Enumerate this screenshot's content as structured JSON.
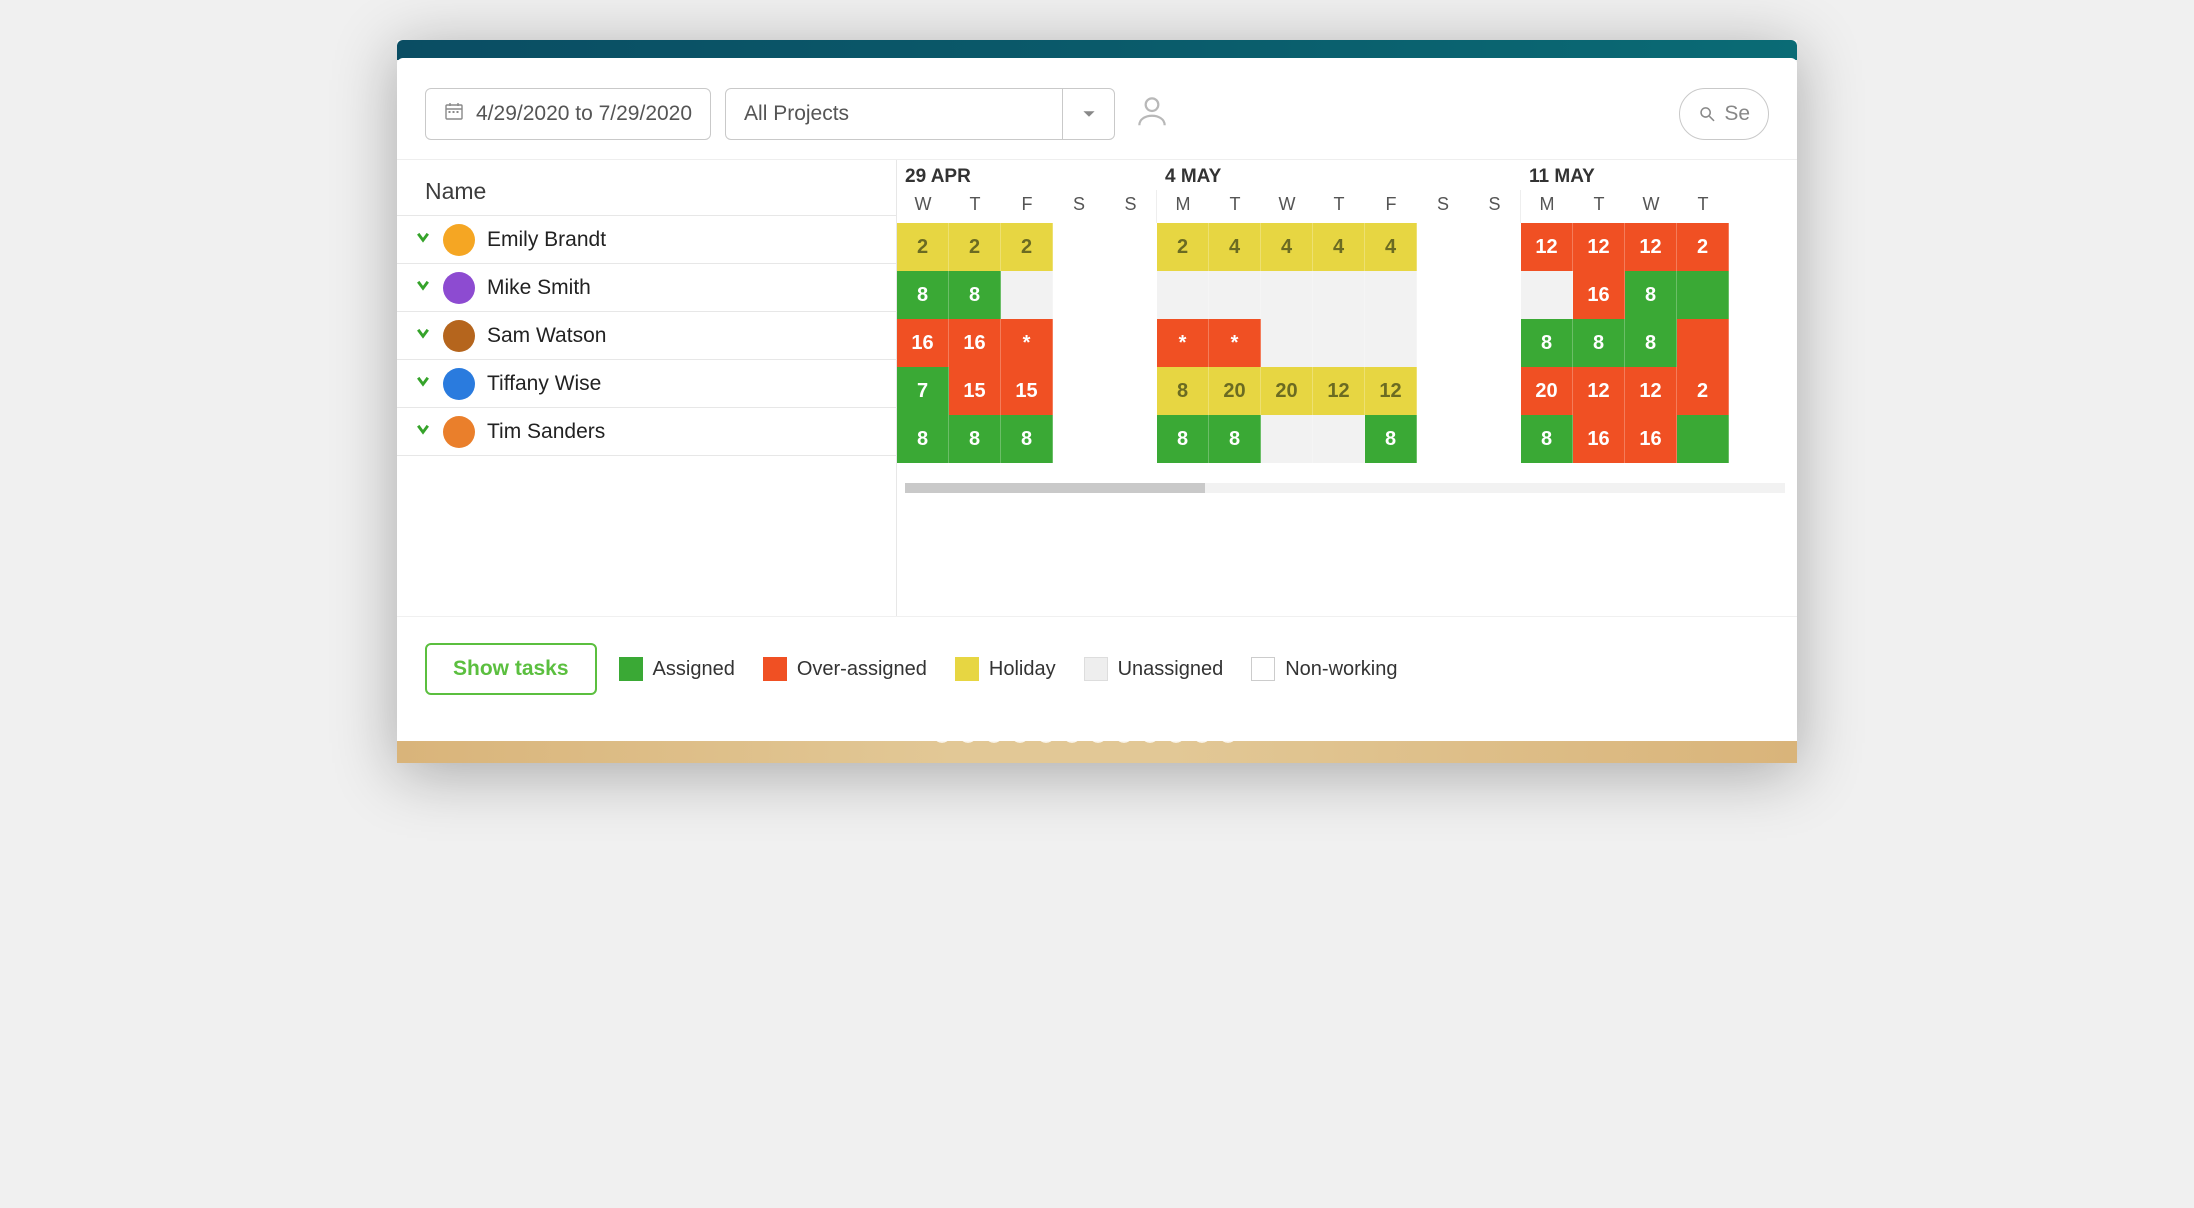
{
  "toolbar": {
    "date_range": "4/29/2020 to 7/29/2020",
    "project_filter": "All Projects",
    "search_placeholder": "Se"
  },
  "header": {
    "name_col": "Name"
  },
  "weeks": [
    {
      "title": "29 APR",
      "days": [
        "W",
        "T",
        "F",
        "S",
        "S"
      ]
    },
    {
      "title": "4 MAY",
      "days": [
        "M",
        "T",
        "W",
        "T",
        "F",
        "S",
        "S"
      ]
    },
    {
      "title": "11 MAY",
      "days": [
        "M",
        "T",
        "W",
        "T"
      ]
    }
  ],
  "rows": [
    {
      "name": "Emily Brandt",
      "avatar": "#f5a623",
      "cells": [
        {
          "v": "2",
          "c": "y"
        },
        {
          "v": "2",
          "c": "y"
        },
        {
          "v": "2",
          "c": "y"
        },
        {
          "v": "",
          "c": "nw"
        },
        {
          "v": "",
          "c": "nw"
        },
        {
          "v": "2",
          "c": "y"
        },
        {
          "v": "4",
          "c": "y"
        },
        {
          "v": "4",
          "c": "y"
        },
        {
          "v": "4",
          "c": "y"
        },
        {
          "v": "4",
          "c": "y"
        },
        {
          "v": "",
          "c": "nw"
        },
        {
          "v": "",
          "c": "nw"
        },
        {
          "v": "12",
          "c": "r"
        },
        {
          "v": "12",
          "c": "r"
        },
        {
          "v": "12",
          "c": "r"
        },
        {
          "v": "2",
          "c": "r"
        }
      ]
    },
    {
      "name": "Mike Smith",
      "avatar": "#8d4bd1",
      "cells": [
        {
          "v": "8",
          "c": "g"
        },
        {
          "v": "8",
          "c": "g"
        },
        {
          "v": "",
          "c": "ua"
        },
        {
          "v": "",
          "c": "nw"
        },
        {
          "v": "",
          "c": "nw"
        },
        {
          "v": "",
          "c": "ua"
        },
        {
          "v": "",
          "c": "ua"
        },
        {
          "v": "",
          "c": "ua"
        },
        {
          "v": "",
          "c": "ua"
        },
        {
          "v": "",
          "c": "ua"
        },
        {
          "v": "",
          "c": "nw"
        },
        {
          "v": "",
          "c": "nw"
        },
        {
          "v": "",
          "c": "ua"
        },
        {
          "v": "16",
          "c": "r"
        },
        {
          "v": "8",
          "c": "g"
        },
        {
          "v": "",
          "c": "g"
        }
      ]
    },
    {
      "name": "Sam Watson",
      "avatar": "#b5651d",
      "cells": [
        {
          "v": "16",
          "c": "r"
        },
        {
          "v": "16",
          "c": "r"
        },
        {
          "v": "*",
          "c": "r"
        },
        {
          "v": "",
          "c": "nw"
        },
        {
          "v": "",
          "c": "nw"
        },
        {
          "v": "*",
          "c": "r"
        },
        {
          "v": "*",
          "c": "r"
        },
        {
          "v": "",
          "c": "ua"
        },
        {
          "v": "",
          "c": "ua"
        },
        {
          "v": "",
          "c": "ua"
        },
        {
          "v": "",
          "c": "nw"
        },
        {
          "v": "",
          "c": "nw"
        },
        {
          "v": "8",
          "c": "g"
        },
        {
          "v": "8",
          "c": "g"
        },
        {
          "v": "8",
          "c": "g"
        },
        {
          "v": "",
          "c": "r"
        }
      ]
    },
    {
      "name": "Tiffany Wise",
      "avatar": "#2a7bde",
      "cells": [
        {
          "v": "7",
          "c": "g"
        },
        {
          "v": "15",
          "c": "r"
        },
        {
          "v": "15",
          "c": "r"
        },
        {
          "v": "",
          "c": "nw"
        },
        {
          "v": "",
          "c": "nw"
        },
        {
          "v": "8",
          "c": "y"
        },
        {
          "v": "20",
          "c": "y"
        },
        {
          "v": "20",
          "c": "y"
        },
        {
          "v": "12",
          "c": "y"
        },
        {
          "v": "12",
          "c": "y"
        },
        {
          "v": "",
          "c": "nw"
        },
        {
          "v": "",
          "c": "nw"
        },
        {
          "v": "20",
          "c": "r"
        },
        {
          "v": "12",
          "c": "r"
        },
        {
          "v": "12",
          "c": "r"
        },
        {
          "v": "2",
          "c": "r"
        }
      ]
    },
    {
      "name": "Tim Sanders",
      "avatar": "#ea7f2b",
      "cells": [
        {
          "v": "8",
          "c": "g"
        },
        {
          "v": "8",
          "c": "g"
        },
        {
          "v": "8",
          "c": "g"
        },
        {
          "v": "",
          "c": "nw"
        },
        {
          "v": "",
          "c": "nw"
        },
        {
          "v": "8",
          "c": "g"
        },
        {
          "v": "8",
          "c": "g"
        },
        {
          "v": "",
          "c": "ua"
        },
        {
          "v": "",
          "c": "ua"
        },
        {
          "v": "8",
          "c": "g"
        },
        {
          "v": "",
          "c": "nw"
        },
        {
          "v": "",
          "c": "nw"
        },
        {
          "v": "8",
          "c": "g"
        },
        {
          "v": "16",
          "c": "r"
        },
        {
          "v": "16",
          "c": "r"
        },
        {
          "v": "",
          "c": "g"
        }
      ]
    }
  ],
  "footer": {
    "show_tasks": "Show tasks",
    "legend": [
      {
        "label": "Assigned",
        "swatch": "sw-g"
      },
      {
        "label": "Over-assigned",
        "swatch": "sw-r"
      },
      {
        "label": "Holiday",
        "swatch": "sw-y"
      },
      {
        "label": "Unassigned",
        "swatch": "sw-ua"
      },
      {
        "label": "Non-working",
        "swatch": "sw-nw"
      }
    ]
  },
  "chart_data": {
    "type": "heatmap",
    "title": "Resource workload (hours/day)",
    "dates": [
      "2020-04-29",
      "2020-04-30",
      "2020-05-01",
      "2020-05-02",
      "2020-05-03",
      "2020-05-04",
      "2020-05-05",
      "2020-05-06",
      "2020-05-07",
      "2020-05-08",
      "2020-05-09",
      "2020-05-10",
      "2020-05-11",
      "2020-05-12",
      "2020-05-13",
      "2020-05-14"
    ],
    "weekday": [
      "W",
      "T",
      "F",
      "S",
      "S",
      "M",
      "T",
      "W",
      "T",
      "F",
      "S",
      "S",
      "M",
      "T",
      "W",
      "T"
    ],
    "people": [
      "Emily Brandt",
      "Mike Smith",
      "Sam Watson",
      "Tiffany Wise",
      "Tim Sanders"
    ],
    "status_codes": {
      "g": "Assigned",
      "r": "Over-assigned",
      "y": "Holiday",
      "ua": "Unassigned",
      "nw": "Non-working"
    },
    "hours": [
      [
        2,
        2,
        2,
        null,
        null,
        2,
        4,
        4,
        4,
        4,
        null,
        null,
        12,
        12,
        12,
        2
      ],
      [
        8,
        8,
        null,
        null,
        null,
        null,
        null,
        null,
        null,
        null,
        null,
        null,
        null,
        16,
        8,
        null
      ],
      [
        16,
        16,
        null,
        null,
        null,
        null,
        null,
        null,
        null,
        null,
        null,
        null,
        8,
        8,
        8,
        null
      ],
      [
        7,
        15,
        15,
        null,
        null,
        8,
        20,
        20,
        12,
        12,
        null,
        null,
        20,
        12,
        12,
        2
      ],
      [
        8,
        8,
        8,
        null,
        null,
        8,
        8,
        null,
        null,
        8,
        null,
        null,
        8,
        16,
        16,
        null
      ]
    ],
    "status": [
      [
        "y",
        "y",
        "y",
        "nw",
        "nw",
        "y",
        "y",
        "y",
        "y",
        "y",
        "nw",
        "nw",
        "r",
        "r",
        "r",
        "r"
      ],
      [
        "g",
        "g",
        "ua",
        "nw",
        "nw",
        "ua",
        "ua",
        "ua",
        "ua",
        "ua",
        "nw",
        "nw",
        "ua",
        "r",
        "g",
        "g"
      ],
      [
        "r",
        "r",
        "r",
        "nw",
        "nw",
        "r",
        "r",
        "ua",
        "ua",
        "ua",
        "nw",
        "nw",
        "g",
        "g",
        "g",
        "r"
      ],
      [
        "g",
        "r",
        "r",
        "nw",
        "nw",
        "y",
        "y",
        "y",
        "y",
        "y",
        "nw",
        "nw",
        "r",
        "r",
        "r",
        "r"
      ],
      [
        "g",
        "g",
        "g",
        "nw",
        "nw",
        "g",
        "g",
        "ua",
        "ua",
        "g",
        "nw",
        "nw",
        "g",
        "r",
        "r",
        "g"
      ]
    ]
  }
}
